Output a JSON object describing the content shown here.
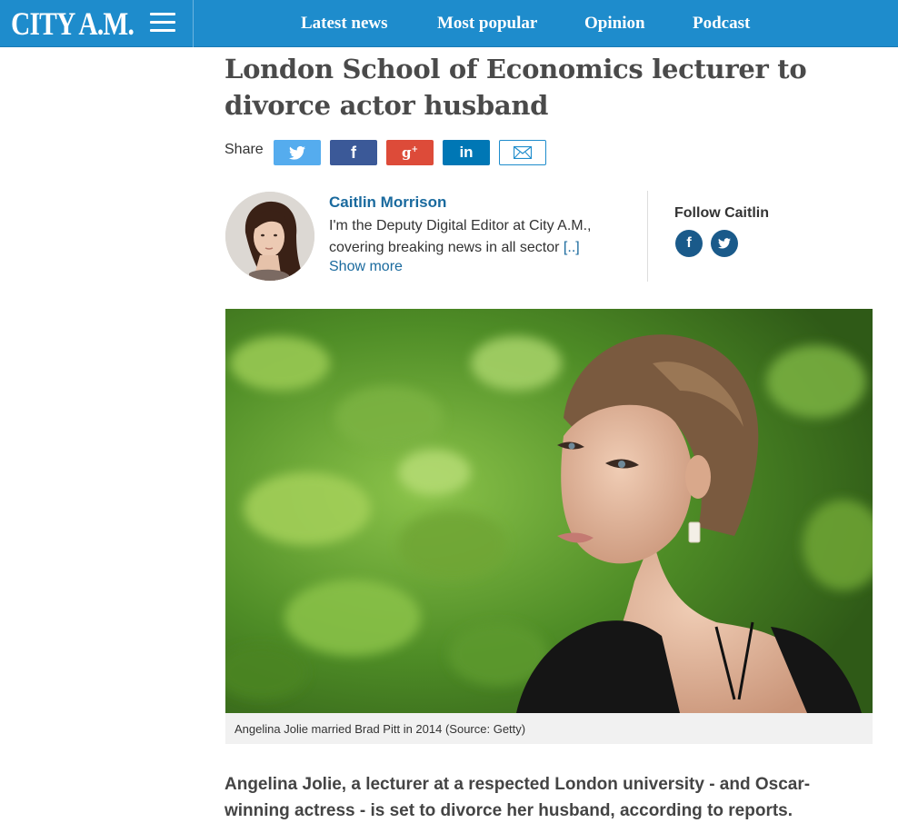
{
  "header": {
    "logo": "CITY A.M.",
    "nav": [
      "Latest news",
      "Most popular",
      "Opinion",
      "Podcast"
    ]
  },
  "article": {
    "headline": "London School of Economics lecturer to divorce actor husband",
    "share_label": "Share",
    "share_buttons": [
      "twitter-icon",
      "facebook-icon",
      "google-plus-icon",
      "linkedin-icon",
      "email-icon"
    ],
    "author": {
      "name": "Caitlin Morrison",
      "bio": "I'm the Deputy Digital Editor at City A.M., covering breaking news in all sector",
      "bio_more": "[..]",
      "show_more": "Show more",
      "follow_label": "Follow Caitlin"
    },
    "image_caption": "Angelina Jolie married Brad Pitt in 2014 (Source: Getty)",
    "intro": "Angelina Jolie, a lecturer at a respected London university - and Oscar-winning actress - is set to divorce her husband, according to reports."
  },
  "colors": {
    "brand": "#1e8ccc",
    "link": "#1a6a9e",
    "twitter": "#55acee",
    "facebook": "#3b5998",
    "google_plus": "#dd4b39",
    "linkedin": "#0077b5"
  }
}
